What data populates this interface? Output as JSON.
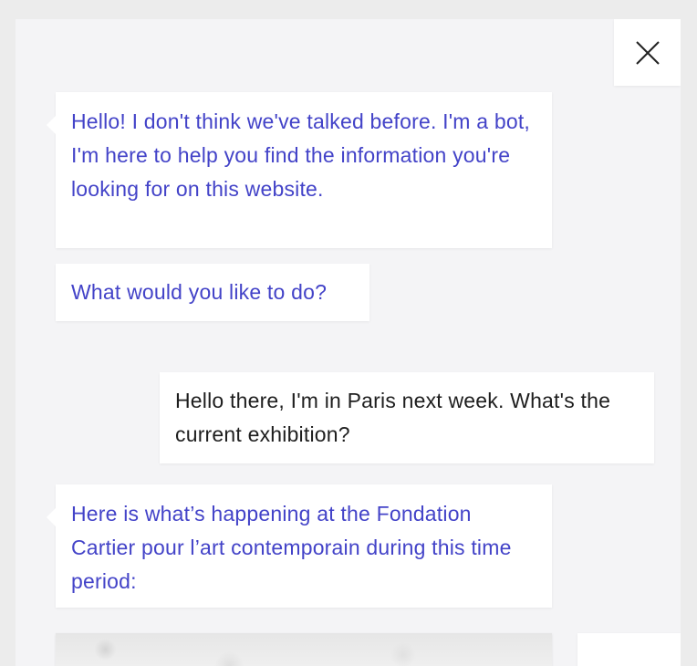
{
  "chat": {
    "close_icon": "close-icon",
    "messages": [
      {
        "sender": "bot",
        "text": "Hello! I don't think we've talked before. I'm a bot, I'm here to help you find the information you're looking for on this website."
      },
      {
        "sender": "bot",
        "text": "What would you like to do?"
      },
      {
        "sender": "user",
        "text": "Hello there, I'm in Paris next week. What's the current exhibition?"
      },
      {
        "sender": "bot",
        "text": "Here is what’s happening at the Fondation Cartier pour l’art contemporain during this time period:"
      }
    ]
  },
  "colors": {
    "bot_text": "#4343c8",
    "user_text": "#1e1e1e",
    "panel_bg": "#f4f4f6",
    "bubble_bg": "#ffffff"
  }
}
